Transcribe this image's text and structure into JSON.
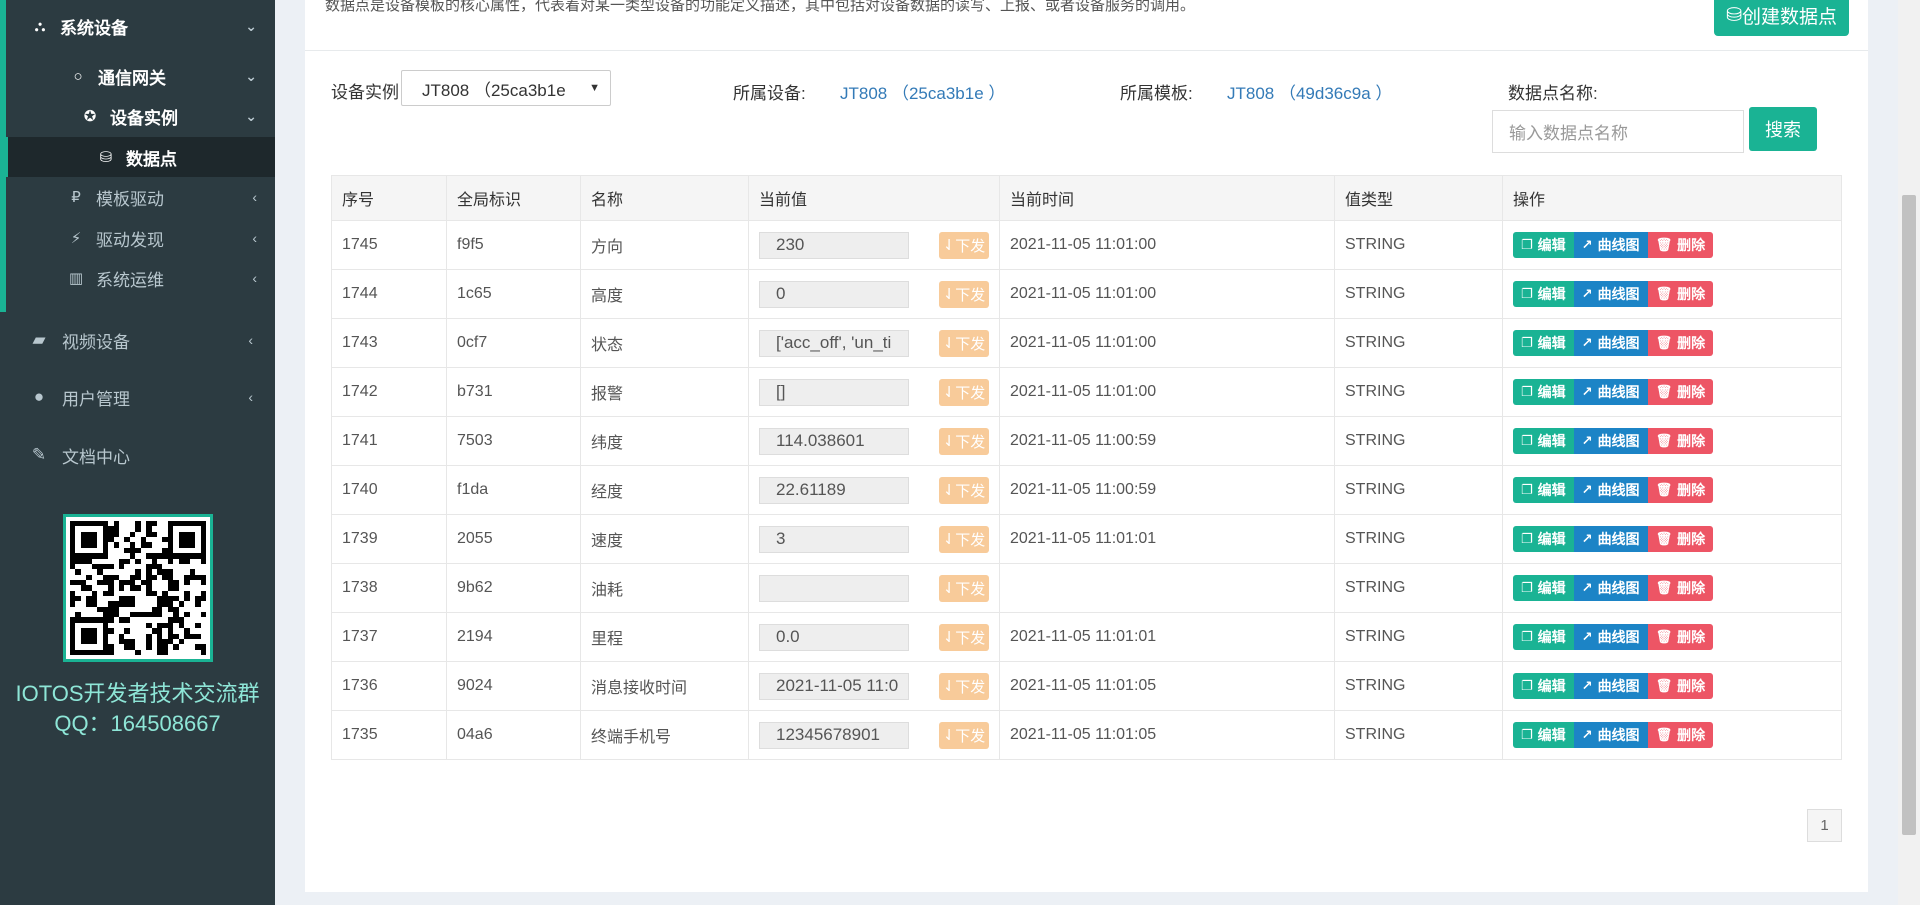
{
  "sidebar": {
    "items": [
      {
        "label": "系统设备",
        "icon": "sitemap-icon",
        "chevron": "⌄"
      },
      {
        "label": "通信网关",
        "icon": "circle-icon",
        "chevron": "⌄"
      },
      {
        "label": "设备实例",
        "icon": "rebel-icon",
        "chevron": "⌄"
      },
      {
        "label": "数据点",
        "icon": "database-icon"
      },
      {
        "label": "模板驱动",
        "icon": "ruble-icon",
        "chevron": "‹"
      },
      {
        "label": "驱动发现",
        "icon": "plug-icon",
        "chevron": "‹"
      },
      {
        "label": "系统运维",
        "icon": "bar-chart-icon",
        "chevron": "‹"
      }
    ],
    "top_items": [
      {
        "label": "视频设备",
        "icon": "video-camera-icon",
        "chevron": "‹"
      },
      {
        "label": "用户管理",
        "icon": "user-icon",
        "chevron": "‹"
      },
      {
        "label": "文档中心",
        "icon": "edit-icon"
      }
    ],
    "qr_caption_1": "IOTOS开发者技术交流群",
    "qr_caption_2": "QQ：164508667"
  },
  "header": {
    "description": "数据点是设备模板的核心属性，代表着对某一类型设备的功能定义描述，其中包括对设备数据的读写、上报、或者设备服务的调用。",
    "create_button": "创建数据点"
  },
  "filters": {
    "instance_label": "设备实例",
    "instance_value": "JT808 （25ca3b1e",
    "device_label": "所属设备:",
    "device_value": "JT808 （25ca3b1e ）",
    "template_label": "所属模板:",
    "template_value": "JT808 （49d36c9a ）",
    "name_label": "数据点名称:",
    "name_placeholder": "输入数据点名称",
    "search_button": "搜索"
  },
  "table": {
    "columns": [
      "序号",
      "全局标识",
      "名称",
      "当前值",
      "当前时间",
      "值类型",
      "操作"
    ],
    "send_label": "下发",
    "edit_label": "编辑",
    "chart_label": "曲线图",
    "delete_label": "删除",
    "rows": [
      {
        "id": "1745",
        "gid": "f9f5",
        "name": "方向",
        "value": "230",
        "time": "2021-11-05 11:01:00",
        "type": "STRING"
      },
      {
        "id": "1744",
        "gid": "1c65",
        "name": "高度",
        "value": "0",
        "time": "2021-11-05 11:01:00",
        "type": "STRING"
      },
      {
        "id": "1743",
        "gid": "0cf7",
        "name": "状态",
        "value": "['acc_off', 'un_ti",
        "time": "2021-11-05 11:01:00",
        "type": "STRING"
      },
      {
        "id": "1742",
        "gid": "b731",
        "name": "报警",
        "value": "[]",
        "time": "2021-11-05 11:01:00",
        "type": "STRING"
      },
      {
        "id": "1741",
        "gid": "7503",
        "name": "纬度",
        "value": "114.038601",
        "time": "2021-11-05 11:00:59",
        "type": "STRING"
      },
      {
        "id": "1740",
        "gid": "f1da",
        "name": "经度",
        "value": "22.61189",
        "time": "2021-11-05 11:00:59",
        "type": "STRING"
      },
      {
        "id": "1739",
        "gid": "2055",
        "name": "速度",
        "value": "3",
        "time": "2021-11-05 11:01:01",
        "type": "STRING"
      },
      {
        "id": "1738",
        "gid": "9b62",
        "name": "油耗",
        "value": "",
        "time": "",
        "type": "STRING"
      },
      {
        "id": "1737",
        "gid": "2194",
        "name": "里程",
        "value": "0.0",
        "time": "2021-11-05 11:01:01",
        "type": "STRING"
      },
      {
        "id": "1736",
        "gid": "9024",
        "name": "消息接收时间",
        "value": "2021-11-05 11:0",
        "time": "2021-11-05 11:01:05",
        "type": "STRING"
      },
      {
        "id": "1735",
        "gid": "04a6",
        "name": "终端手机号",
        "value": "12345678901",
        "time": "2021-11-05 11:01:05",
        "type": "STRING"
      }
    ]
  },
  "pagination": {
    "current": "1"
  },
  "colors": {
    "accent": "#1ab394",
    "link": "#337ab7",
    "sidebar": "#2c3b41",
    "danger": "#ed5565",
    "info": "#1c84c6",
    "warning": "#f8cb9a"
  }
}
